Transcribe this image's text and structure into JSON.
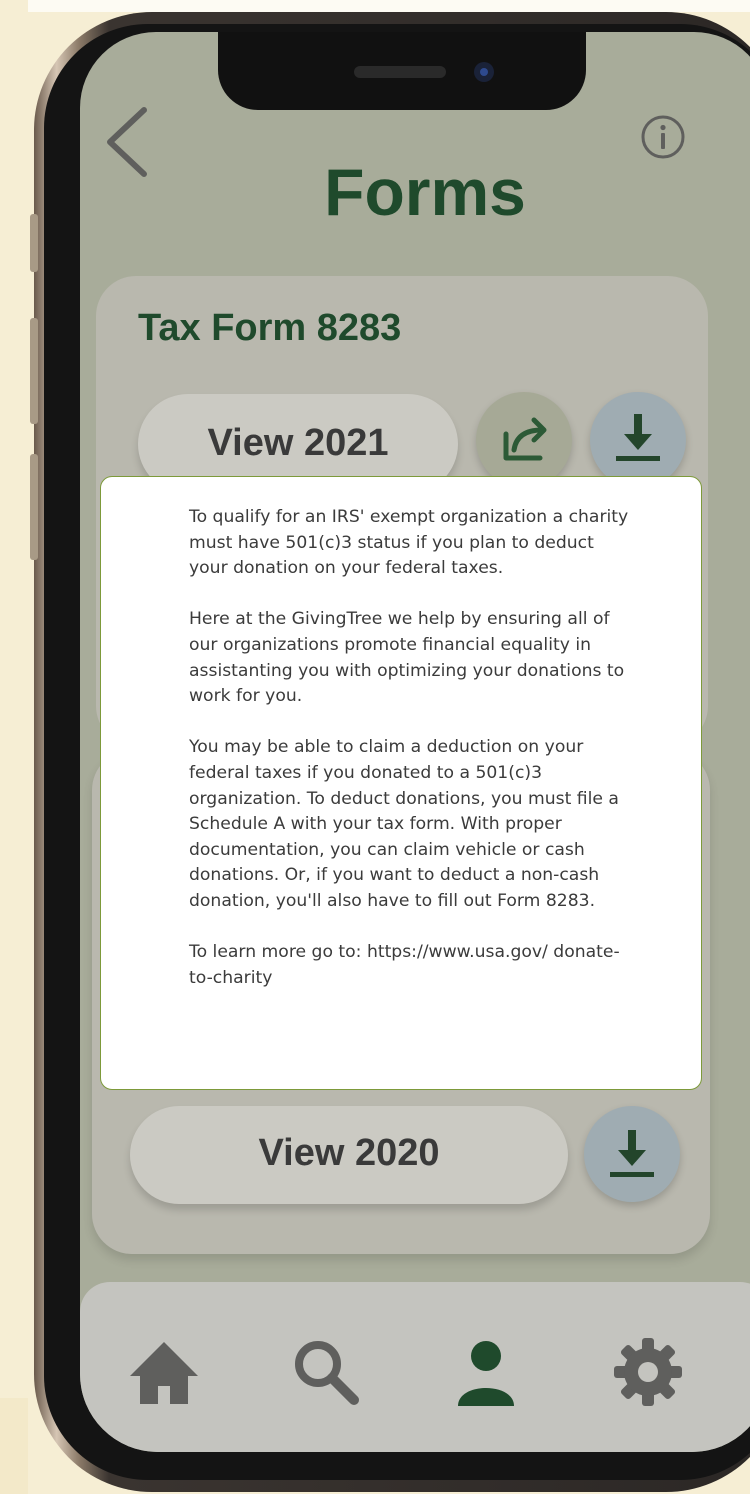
{
  "header": {
    "title": "Forms",
    "back_icon": "chevron-left-icon",
    "info_icon": "info-circle-icon"
  },
  "cards": [
    {
      "title": "Tax Form 8283",
      "view_label": "View 2021",
      "actions": [
        "share-icon",
        "download-icon"
      ]
    },
    {
      "title": "",
      "view_label": "View 2020",
      "actions": [
        "download-icon"
      ]
    }
  ],
  "modal": {
    "paragraphs": [
      "To qualify for an IRS' exempt organization a charity must have 501(c)3 status if you plan to deduct your donation on your federal taxes.",
      "Here at the GivingTree we help by ensuring all of our organizations promote financial equality in assistanting you with optimizing your donations to work for you.",
      "You may be able to claim a deduction on your federal taxes if you donated to a 501(c)3 organization. To deduct donations, you must file a Schedule A with your tax form. With proper documentation, you can claim vehicle or cash donations. Or, if you want to deduct a non-cash donation, you'll also have to fill out Form 8283.",
      "To learn more go to: https://www.usa.gov/ donate-to-charity"
    ]
  },
  "tabbar": {
    "items": [
      {
        "icon": "home-icon",
        "active": false
      },
      {
        "icon": "search-icon",
        "active": false
      },
      {
        "icon": "profile-icon",
        "active": true
      },
      {
        "icon": "gear-icon",
        "active": false
      }
    ]
  },
  "colors": {
    "background": "#f6eed4",
    "screen": "#a8ac9a",
    "accent_green": "#1f4a2c",
    "card": "#b9b8ae",
    "download_button": "#9facb2",
    "share_button": "#a6a996",
    "icon_gray": "#5f5f5d",
    "modal_border": "#7d9a3a"
  }
}
